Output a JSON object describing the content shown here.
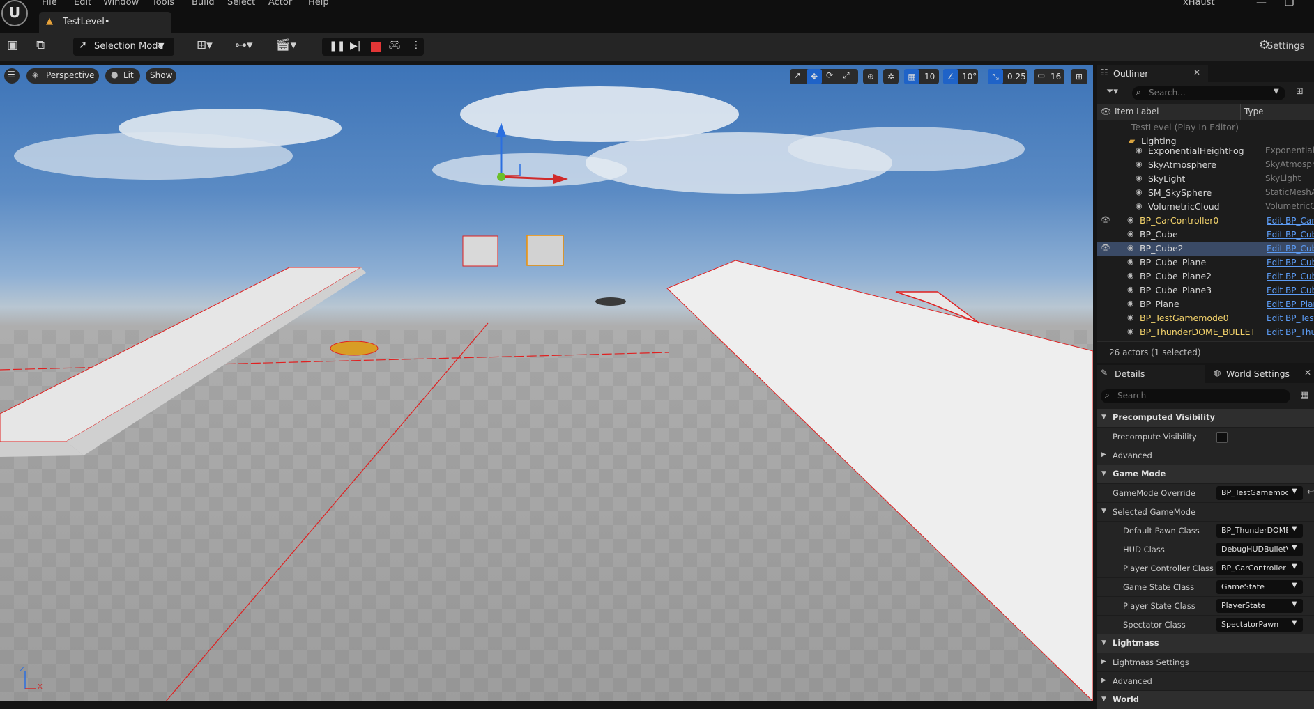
{
  "menu": {
    "items": [
      "File",
      "Edit",
      "Window",
      "Tools",
      "Build",
      "Select",
      "Actor",
      "Help"
    ]
  },
  "tab": {
    "title": "TestLevel•"
  },
  "app": {
    "title": "xHaust"
  },
  "toolbar": {
    "mode_label": "Selection Mode",
    "settings_label": "Settings"
  },
  "viewport": {
    "perspective": "Perspective",
    "lit": "Lit",
    "show": "Show",
    "grid_snap": "10",
    "rotate_snap": "10°",
    "scale_snap": "0.25",
    "camera_speed": "16",
    "axis_labels": {
      "x": "X",
      "z": "Z"
    }
  },
  "outliner": {
    "title": "Outliner",
    "search_placeholder": "Search...",
    "col_label": "Item Label",
    "col_type": "Type",
    "level_row": "TestLevel (Play In Editor)",
    "folder": "Lighting",
    "rows": [
      {
        "label": "ExponentialHeightFog",
        "type": "ExponentialHeightFog"
      },
      {
        "label": "SkyAtmosphere",
        "type": "SkyAtmosphere"
      },
      {
        "label": "SkyLight",
        "type": "SkyLight"
      },
      {
        "label": "SM_SkySphere",
        "type": "StaticMeshActor"
      },
      {
        "label": "VolumetricCloud",
        "type": "VolumetricCloud"
      },
      {
        "label": "BP_CarController0",
        "type": "Edit BP_CarController"
      },
      {
        "label": "BP_Cube",
        "type": "Edit BP_Cube"
      },
      {
        "label": "BP_Cube2",
        "type": "Edit BP_Cube"
      },
      {
        "label": "BP_Cube_Plane",
        "type": "Edit BP_Cube"
      },
      {
        "label": "BP_Cube_Plane2",
        "type": "Edit BP_Cube"
      },
      {
        "label": "BP_Cube_Plane3",
        "type": "Edit BP_Cube"
      },
      {
        "label": "BP_Plane",
        "type": "Edit BP_Plane"
      },
      {
        "label": "BP_TestGamemode0",
        "type": "Edit BP_TestGamemode"
      },
      {
        "label": "BP_ThunderDOME_BULLET",
        "type": "Edit BP_ThunderDOME"
      }
    ],
    "status": "26 actors (1 selected)"
  },
  "details": {
    "tab_details": "Details",
    "tab_world": "World Settings",
    "search_placeholder": "Search",
    "sec_precomputed": "Precomputed Visibility",
    "precompute_label": "Precompute Visibility",
    "advanced1": "Advanced",
    "sec_gamemode": "Game Mode",
    "gamemode_override_label": "GameMode Override",
    "gamemode_override_value": "BP_TestGamemode",
    "selected_gamemode": "Selected GameMode",
    "props": [
      {
        "label": "Default Pawn Class",
        "value": "BP_ThunderDOME"
      },
      {
        "label": "HUD Class",
        "value": "DebugHUDBulletV"
      },
      {
        "label": "Player Controller Class",
        "value": "BP_CarController"
      },
      {
        "label": "Game State Class",
        "value": "GameState"
      },
      {
        "label": "Player State Class",
        "value": "PlayerState"
      },
      {
        "label": "Spectator Class",
        "value": "SpectatorPawn"
      }
    ],
    "sec_lightmass": "Lightmass",
    "lightmass_settings": "Lightmass Settings",
    "advanced2": "Advanced",
    "sec_world": "World"
  }
}
